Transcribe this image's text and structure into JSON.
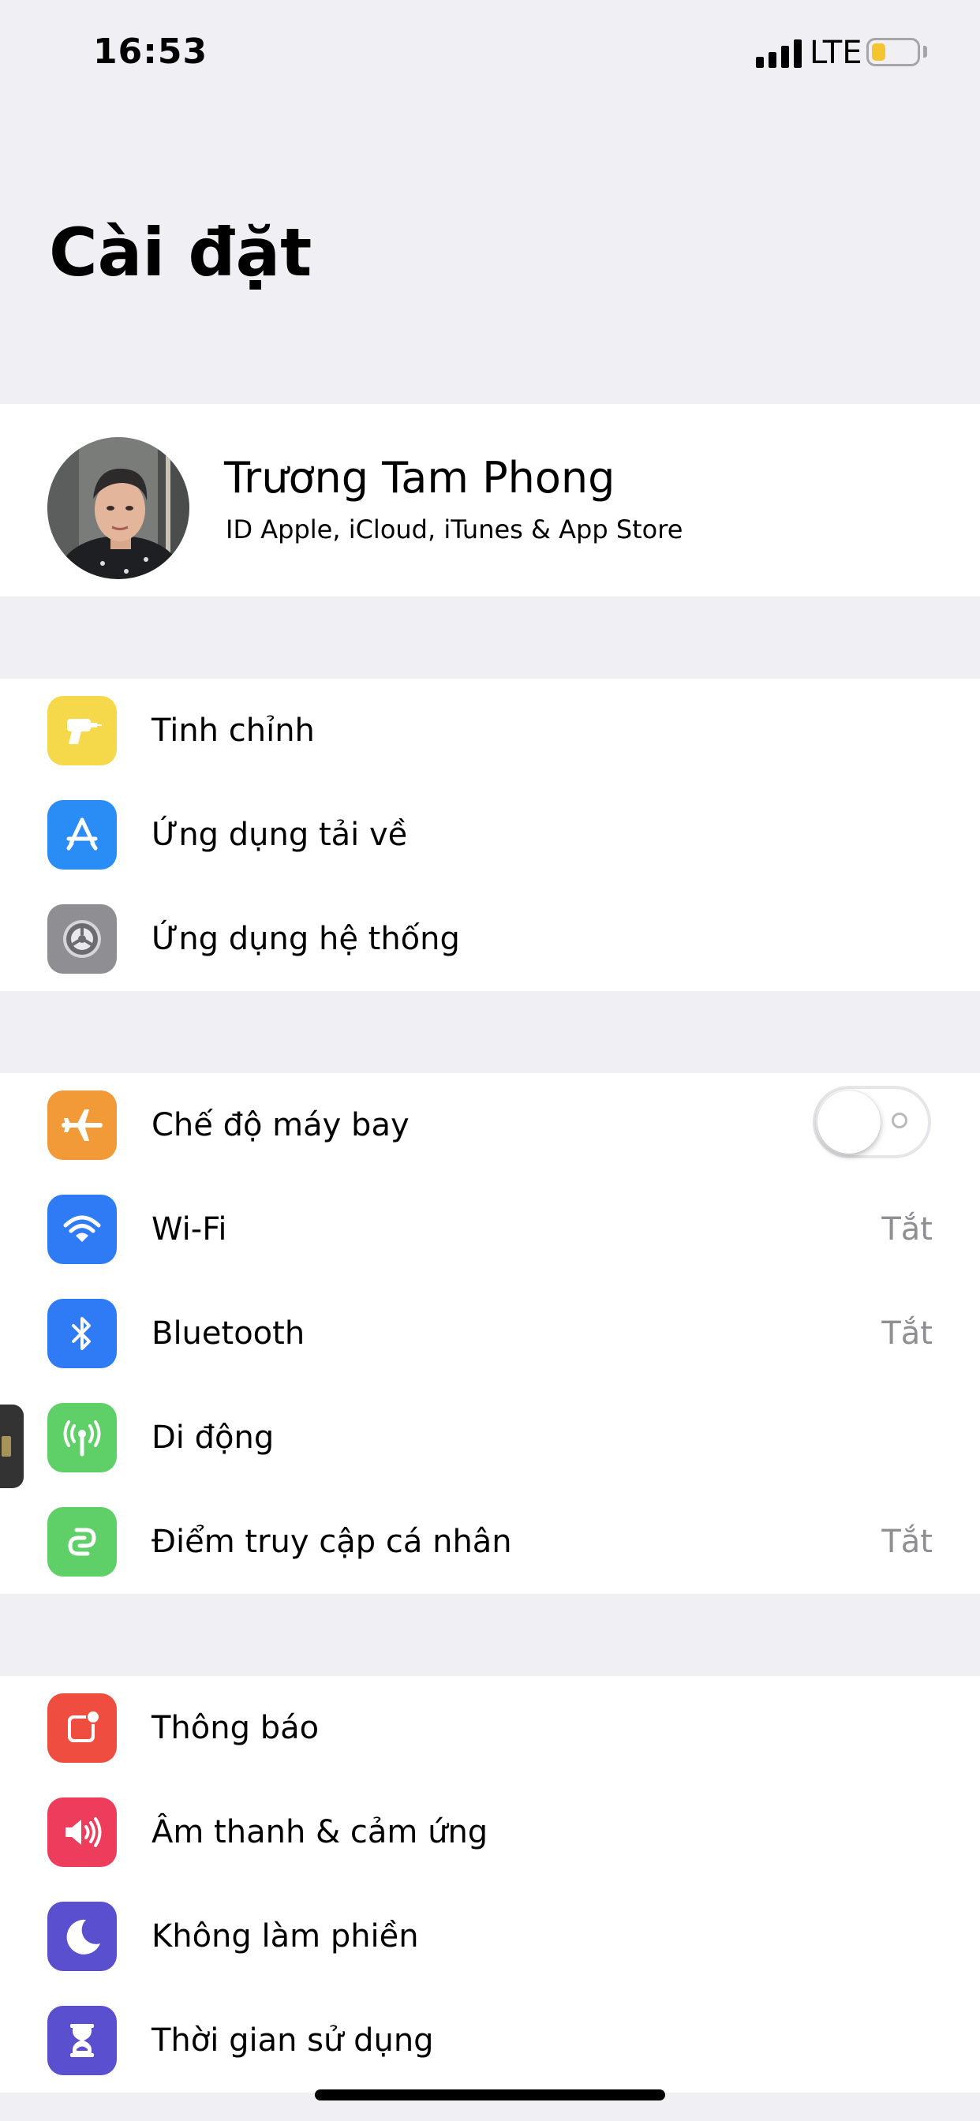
{
  "status_bar": {
    "time": "16:53",
    "network": "LTE",
    "battery_level": 0.3,
    "battery_color": "#f5c530"
  },
  "title": "Cài đặt",
  "profile": {
    "name": "Trương Tam Phong",
    "subtitle": "ID Apple, iCloud, iTunes & App Store"
  },
  "group1": [
    {
      "label": "Tinh chỉnh",
      "icon": "drill-icon",
      "color": "#f5d94a"
    },
    {
      "label": "Ứng dụng tải về",
      "icon": "app-store-icon",
      "color": "#2a8cf5"
    },
    {
      "label": "Ứng dụng hệ thống",
      "icon": "gear-icon",
      "color": "#8e8e93"
    }
  ],
  "group2": [
    {
      "label": "Chế độ máy bay",
      "icon": "airplane-icon",
      "color": "#f29a38",
      "toggle": false
    },
    {
      "label": "Wi-Fi",
      "icon": "wifi-icon",
      "color": "#2f7bf5",
      "value": "Tắt"
    },
    {
      "label": "Bluetooth",
      "icon": "bluetooth-icon",
      "color": "#2f7bf5",
      "value": "Tắt"
    },
    {
      "label": "Di động",
      "icon": "cellular-antenna-icon",
      "color": "#5fd068"
    },
    {
      "label": "Điểm truy cập cá nhân",
      "icon": "hotspot-link-icon",
      "color": "#5fd068",
      "value": "Tắt"
    }
  ],
  "group3": [
    {
      "label": "Thông báo",
      "icon": "notification-icon",
      "color": "#ee4d3f"
    },
    {
      "label": "Âm thanh & cảm ứng",
      "icon": "speaker-icon",
      "color": "#ee3d5c"
    },
    {
      "label": "Không làm phiền",
      "icon": "moon-icon",
      "color": "#5a4fcf"
    },
    {
      "label": "Thời gian sử dụng",
      "icon": "hourglass-icon",
      "color": "#5a4fcf"
    }
  ]
}
